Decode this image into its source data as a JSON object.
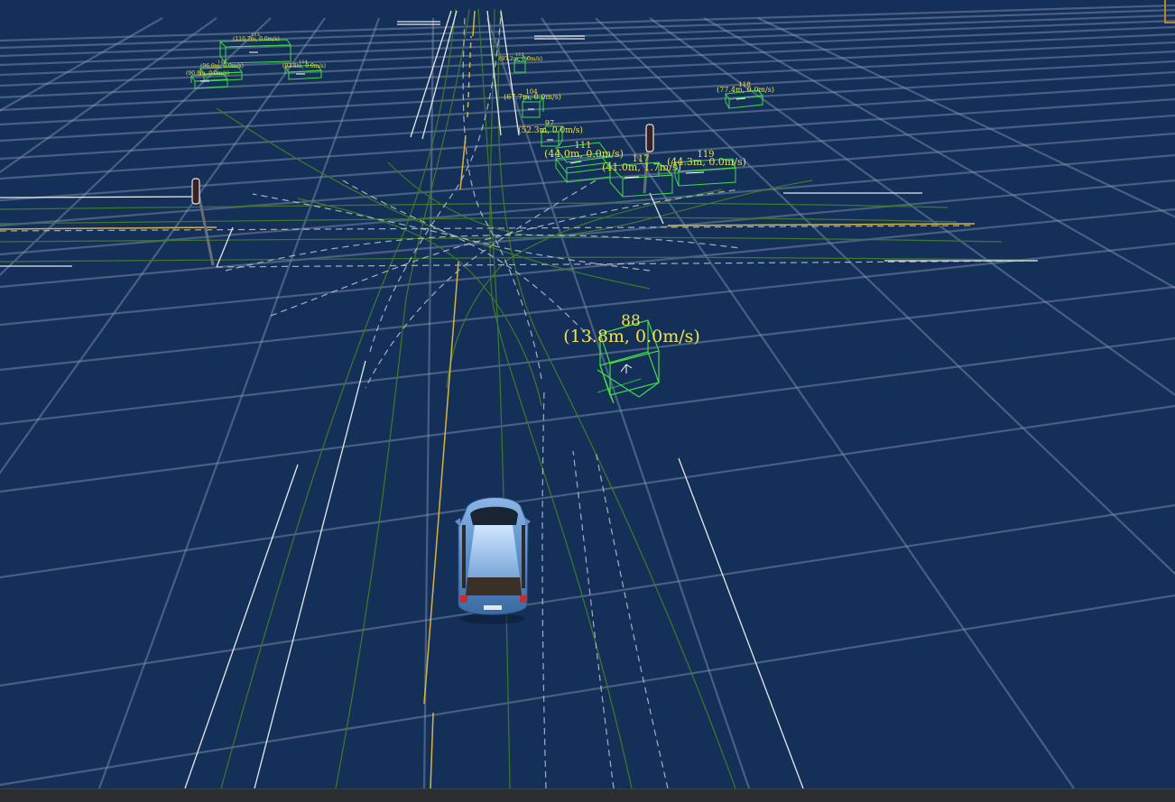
{
  "scene": {
    "background_color": "#153058",
    "grid_color": "#8a99b3",
    "lane_white_color": "#e6e9ee",
    "lane_yellow_color": "#d8b43c",
    "reference_line_color": "#3e7a2a",
    "obstacle_box_color": "#3fdc4a",
    "label_color": "#f3e44a"
  },
  "obstacles": [
    {
      "id": "88",
      "info": "(13.8m, 0.0m/s)"
    },
    {
      "id": "111",
      "info": "(44.0m, 0.0m/s)"
    },
    {
      "id": "117",
      "info": "(41.0m, 1.7m/s)"
    },
    {
      "id": "119",
      "info": "(44.3m, 0.0m/s)"
    },
    {
      "id": "97",
      "info": "(52.3m, 0.0m/s)"
    },
    {
      "id": "104",
      "info": "(67.7m, 0.0m/s)"
    },
    {
      "id": "118",
      "info": "(77.4m, 0.0m/s)"
    },
    {
      "id": "115",
      "info": "(97.2m, 0.0m/s)"
    },
    {
      "id": "113",
      "info": "(110.7m, 0.0m/s)"
    },
    {
      "id": "114",
      "info": "(93.8m, 0.0m/s)"
    },
    {
      "id": "112",
      "info": "(96.0m, 0.0m/s)"
    },
    {
      "id": "110",
      "info": "(90.8m, 0.0m/s)"
    }
  ],
  "ego_vehicle": {
    "icon": "car-icon",
    "color": "#5b8ecb"
  },
  "traffic_lights": [
    {
      "icon": "traffic-light-icon"
    },
    {
      "icon": "traffic-light-icon"
    }
  ]
}
